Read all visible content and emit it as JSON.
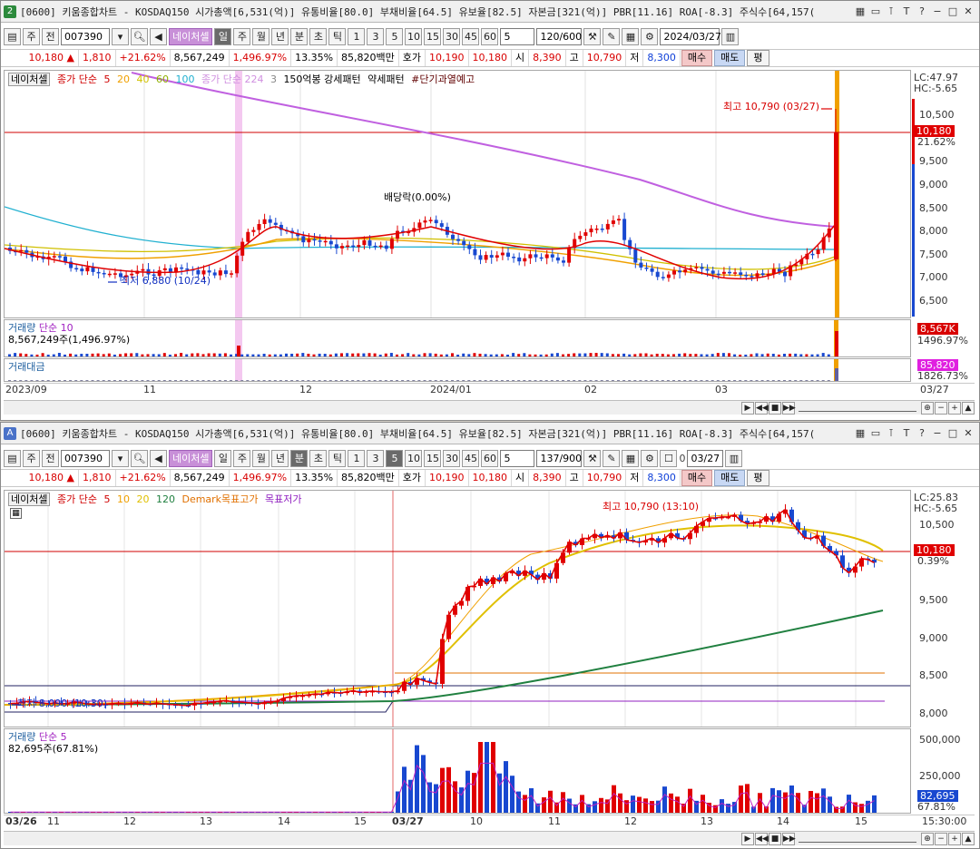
{
  "top": {
    "win_num": "2",
    "title": "[0600] 키움종합차트 - KOSDAQ150 시가총액[6,531(억)] 유통비율[80.0] 부채비율[64.5] 유보율[82.5] 자본금[321(억)] PBR[11.16] ROA[-8.3] 주식수[64,157(",
    "toolbar": {
      "mode": "주",
      "prev": "전",
      "code": "007390",
      "stock_name": "네이처셀",
      "periods": [
        "일",
        "주",
        "월",
        "년",
        "분",
        "초",
        "틱"
      ],
      "active_period": "일",
      "intervals": [
        "1",
        "3",
        "5",
        "10",
        "15",
        "30",
        "45",
        "60"
      ],
      "interval_value": "5",
      "count": "120/600",
      "date": "2024/03/27"
    },
    "pricebar": {
      "price": "10,180",
      "arrow": "▲",
      "change": "1,810",
      "change_pct": "+21.62%",
      "volume": "8,567,249",
      "volume_pct": "1,496.97%",
      "turnover": "13.35%",
      "amount": "85,820백만",
      "quote_label": "호가",
      "ask": "10,190",
      "bid": "10,180",
      "open_label": "시",
      "open": "8,390",
      "high_label": "고",
      "high": "10,790",
      "low_label": "저",
      "low": "8,300",
      "buy": "매수",
      "sell": "매도",
      "flat": "평"
    },
    "legend": {
      "name": "네이처셀",
      "ma_label": "종가 단순",
      "ma_values": [
        "5",
        "20",
        "40",
        "60",
        "100"
      ],
      "ma2_label": "종가 단순 224",
      "ma2_extra": "3",
      "pattern1": "150억봉 강세패턴",
      "pattern2": "약세패턴",
      "pattern3": "#단기과열예고"
    },
    "annotations": {
      "high": "최고 10,790 (03/27)",
      "low": "최저 6,880 (10/24)",
      "dividend": "배당락(0.00%)"
    },
    "right_axis": {
      "lc": "LC:47.97",
      "hc": "HC:-5.65",
      "ticks": [
        "10,500",
        "10,000",
        "9,500",
        "9,000",
        "8,500",
        "8,000",
        "7,500",
        "7,000",
        "6,500"
      ],
      "price_tag": "10,180",
      "price_pct": "21.62%"
    },
    "volume_panel": {
      "label": "거래량",
      "ma": "단순 10",
      "value": "8,567,249주(1,496.97%)",
      "tag": "8,567K",
      "tag_pct": "1496.97%"
    },
    "amount_panel": {
      "label": "거래대금",
      "tag": "85,820",
      "tag_pct": "1826.73%"
    },
    "date_axis": [
      "2023/09",
      "11",
      "12",
      "2024/01",
      "02",
      "03"
    ],
    "date_axis_right": "03/27"
  },
  "bottom": {
    "win_num": "A",
    "title": "[0600] 키움종합차트 - KOSDAQ150 시가총액[6,531(억)] 유통비율[80.0] 부채비율[64.5] 유보율[82.5] 자본금[321(억)] PBR[11.16] ROA[-8.3] 주식수[64,157(",
    "toolbar": {
      "mode": "주",
      "prev": "전",
      "code": "007390",
      "stock_name": "네이처셀",
      "periods": [
        "일",
        "주",
        "월",
        "년",
        "분",
        "초",
        "틱"
      ],
      "active_period": "분",
      "intervals": [
        "1",
        "3",
        "5",
        "10",
        "15",
        "30",
        "45",
        "60"
      ],
      "active_interval": "5",
      "interval_value": "5",
      "count": "137/900",
      "check_value": "0",
      "date": "03/27"
    },
    "pricebar": {
      "price": "10,180",
      "arrow": "▲",
      "change": "1,810",
      "change_pct": "+21.62%",
      "volume": "8,567,249",
      "volume_pct": "1,496.97%",
      "turnover": "13.35%",
      "amount": "85,820백만",
      "quote_label": "호가",
      "ask": "10,190",
      "bid": "10,180",
      "open_label": "시",
      "open": "8,390",
      "high_label": "고",
      "high": "10,790",
      "low_label": "저",
      "low": "8,300",
      "buy": "매수",
      "sell": "매도",
      "flat": "평"
    },
    "legend": {
      "name": "네이처셀",
      "ma_label": "종가 단순",
      "ma_values": [
        "5",
        "10",
        "20",
        "120"
      ],
      "demark_high": "Demark목표고가",
      "demark_low": "목표저가"
    },
    "annotations": {
      "high": "최고 10,790 (13:10)",
      "low": "최저 8,090 (10:30)"
    },
    "right_axis": {
      "lc": "LC:25.83",
      "hc": "HC:-5.65",
      "ticks": [
        "10,500",
        "10,000",
        "9,500",
        "9,000",
        "8,500",
        "8,000"
      ],
      "price_tag": "10,180",
      "price_pct": "0.39%"
    },
    "volume_panel": {
      "label": "거래량",
      "ma": "단순 5",
      "value": "82,695주(67.81%)",
      "ticks": [
        "500,000",
        "250,000"
      ],
      "tag": "82,695",
      "tag_pct": "67.81%"
    },
    "date_axis": [
      "03/26",
      "11",
      "12",
      "13",
      "14",
      "15",
      "03/27",
      "10",
      "11",
      "12",
      "13",
      "14",
      "15"
    ],
    "date_axis_right": "15:30:00"
  },
  "colors": {
    "up": "#e00000",
    "down": "#1848d0",
    "ma5": "#e00000",
    "ma20": "#f0a000",
    "ma224": "#c060e0",
    "ma120": "#208040",
    "cyan": "#20b0d0"
  }
}
